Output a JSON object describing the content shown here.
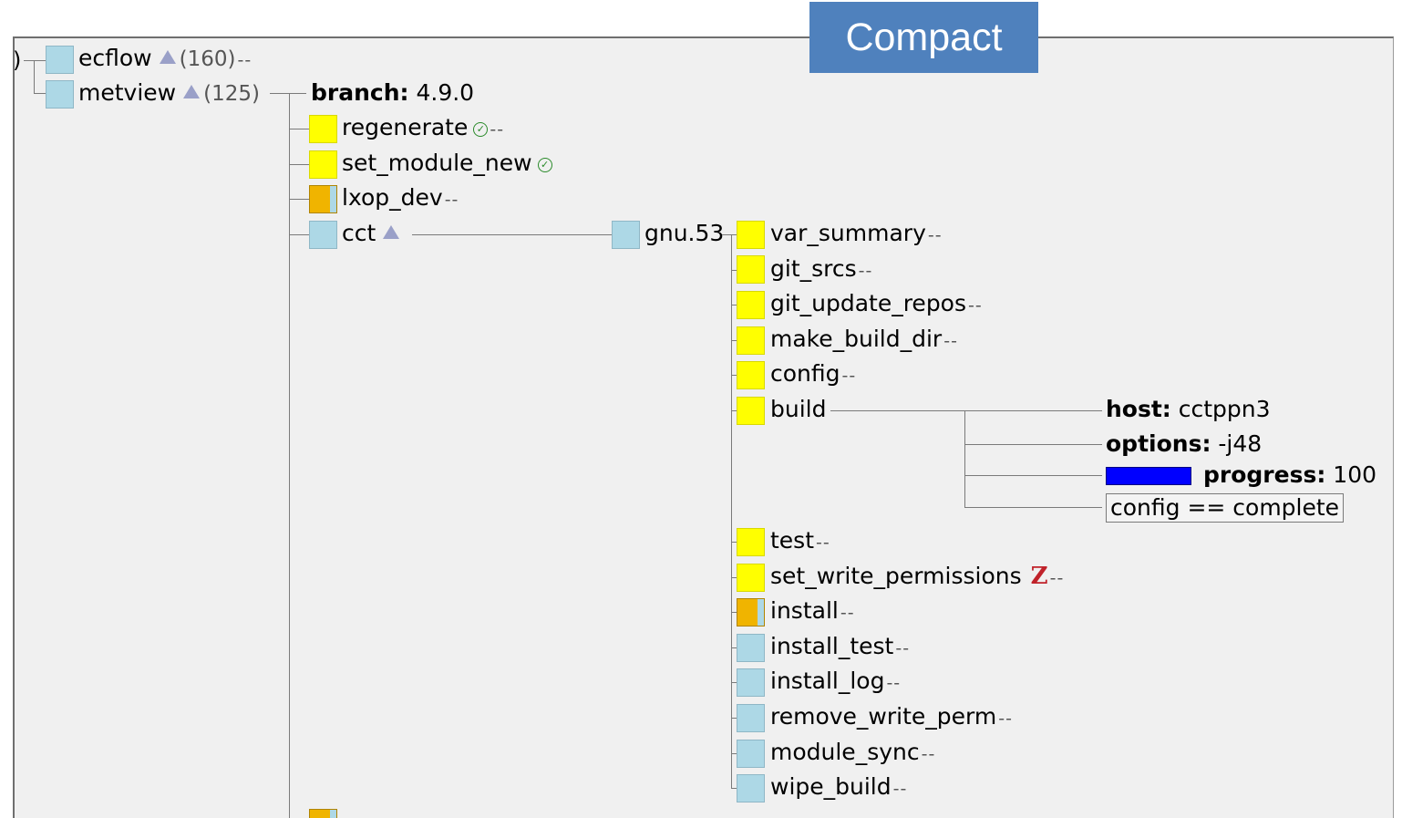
{
  "overlay": {
    "label": "Compact"
  },
  "tree": {
    "left_edge_glyph": ")",
    "suites": [
      {
        "name": "ecflow",
        "count": "(160)",
        "suffix": "--"
      },
      {
        "name": "metview",
        "count": "(125)"
      }
    ],
    "branch_var": {
      "key": "branch:",
      "value": "4.9.0"
    },
    "metview_children": [
      {
        "name": "regenerate",
        "suffix": "--"
      },
      {
        "name": "set_module_new"
      },
      {
        "name": "lxop_dev",
        "suffix": "--"
      },
      {
        "name": "cct"
      }
    ],
    "cct_children": [
      {
        "name": "gnu.53"
      }
    ],
    "gnu_children": [
      {
        "name": "var_summary",
        "suffix": "--"
      },
      {
        "name": "git_srcs",
        "suffix": "--"
      },
      {
        "name": "git_update_repos",
        "suffix": "--"
      },
      {
        "name": "make_build_dir",
        "suffix": "--"
      },
      {
        "name": "config",
        "suffix": "--"
      },
      {
        "name": "build"
      },
      {
        "name": "test",
        "suffix": "--"
      },
      {
        "name": "set_write_permissions",
        "suffix": "--",
        "zombie_glyph": "Z"
      },
      {
        "name": "install",
        "suffix": "--"
      },
      {
        "name": "install_test",
        "suffix": "--"
      },
      {
        "name": "install_log",
        "suffix": "--"
      },
      {
        "name": "remove_write_perm",
        "suffix": "--"
      },
      {
        "name": "module_sync",
        "suffix": "--"
      },
      {
        "name": "wipe_build",
        "suffix": "--"
      }
    ],
    "build_attrs": {
      "host": {
        "key": "host:",
        "value": "cctppn3"
      },
      "options": {
        "key": "options:",
        "value": "-j48"
      },
      "progress": {
        "key": "progress:",
        "value": "100",
        "fraction": 1.0
      },
      "trigger": "config == complete"
    }
  },
  "colors": {
    "queued": "#add8e6",
    "submitted": "#ffff00",
    "active": "#f0b400",
    "panel": "#f0f0f0",
    "overlay": "#4f81bd",
    "progress": "#0000ff"
  },
  "icons": {
    "expand_marker": "triangle-up-icon",
    "complete_marker": "check-circle-icon",
    "zombie_marker": "zombie-z-icon"
  }
}
